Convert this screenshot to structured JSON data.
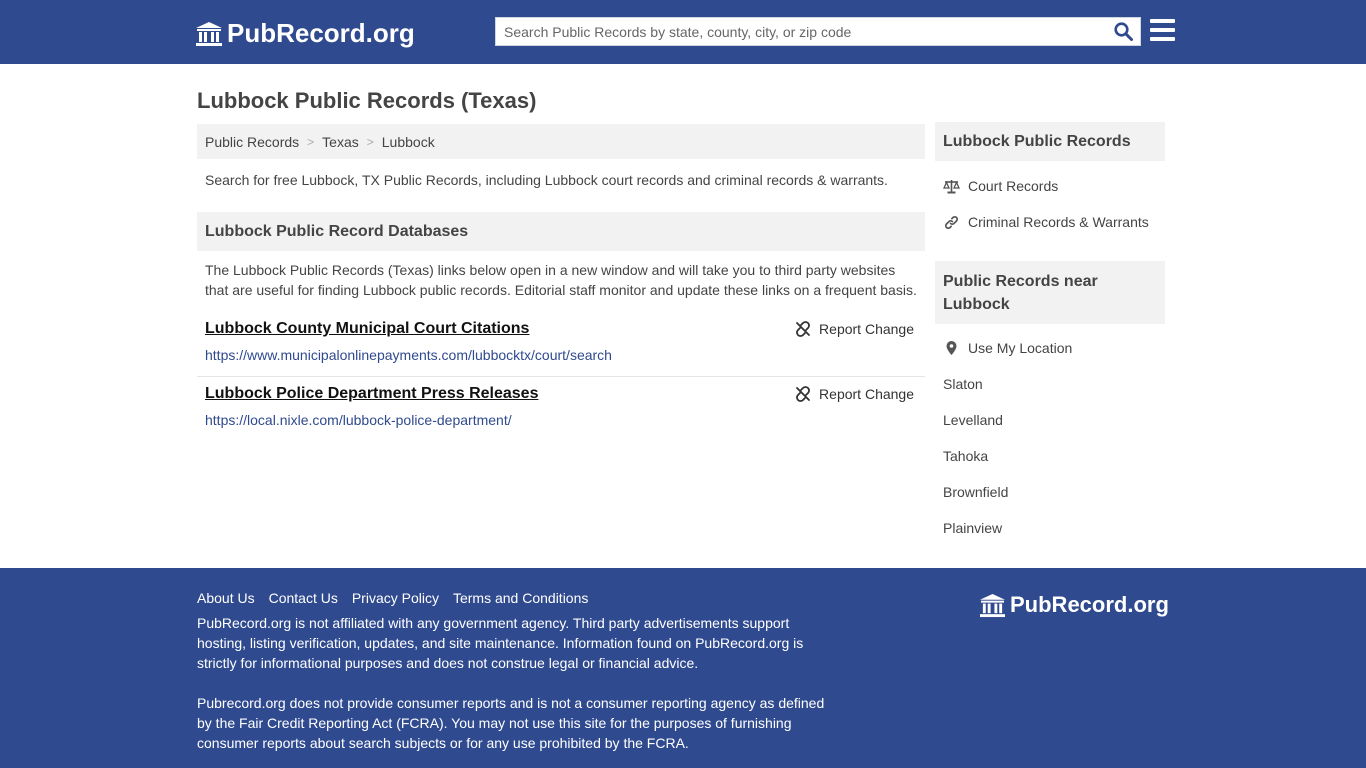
{
  "header": {
    "logo_text": "PubRecord.org",
    "search_placeholder": "Search Public Records by state, county, city, or zip code"
  },
  "main": {
    "title": "Lubbock Public Records (Texas)",
    "breadcrumb": [
      "Public Records",
      "Texas",
      "Lubbock"
    ],
    "intro": "Search for free Lubbock, TX Public Records, including Lubbock court records and criminal records & warrants.",
    "databases_heading": "Lubbock Public Record Databases",
    "databases_desc": "The Lubbock Public Records (Texas) links below open in a new window and will take you to third party websites that are useful for finding Lubbock public records. Editorial staff monitor and update these links on a frequent basis.",
    "records": [
      {
        "title": "Lubbock County Municipal Court Citations",
        "url": "https://www.municipalonlinepayments.com/lubbocktx/court/search",
        "report_label": "Report Change"
      },
      {
        "title": "Lubbock Police Department Press Releases",
        "url": "https://local.nixle.com/lubbock-police-department/",
        "report_label": "Report Change"
      }
    ]
  },
  "sidebar": {
    "box1_title": "Lubbock Public Records",
    "box1_links": [
      {
        "label": "Court Records",
        "icon": "scale-icon"
      },
      {
        "label": "Criminal Records & Warrants",
        "icon": "link-icon"
      }
    ],
    "box2_title": "Public Records near Lubbock",
    "location_label": "Use My Location",
    "nearby": [
      "Slaton",
      "Levelland",
      "Tahoka",
      "Brownfield",
      "Plainview"
    ]
  },
  "footer": {
    "links": [
      "About Us",
      "Contact Us",
      "Privacy Policy",
      "Terms and Conditions"
    ],
    "text1": "PubRecord.org is not affiliated with any government agency. Third party advertisements support hosting, listing verification, updates, and site maintenance. Information found on PubRecord.org is strictly for informational purposes and does not construe legal or financial advice.",
    "text2": "Pubrecord.org does not provide consumer reports and is not a consumer reporting agency as defined by the Fair Credit Reporting Act (FCRA). You may not use this site for the purposes of furnishing consumer reports about search subjects or for any use prohibited by the FCRA.",
    "logo_text": "PubRecord.org"
  },
  "colors": {
    "brand_blue": "#2f4a8f",
    "panel_gray": "#f2f2f2",
    "link_blue": "#2f4a8f"
  }
}
